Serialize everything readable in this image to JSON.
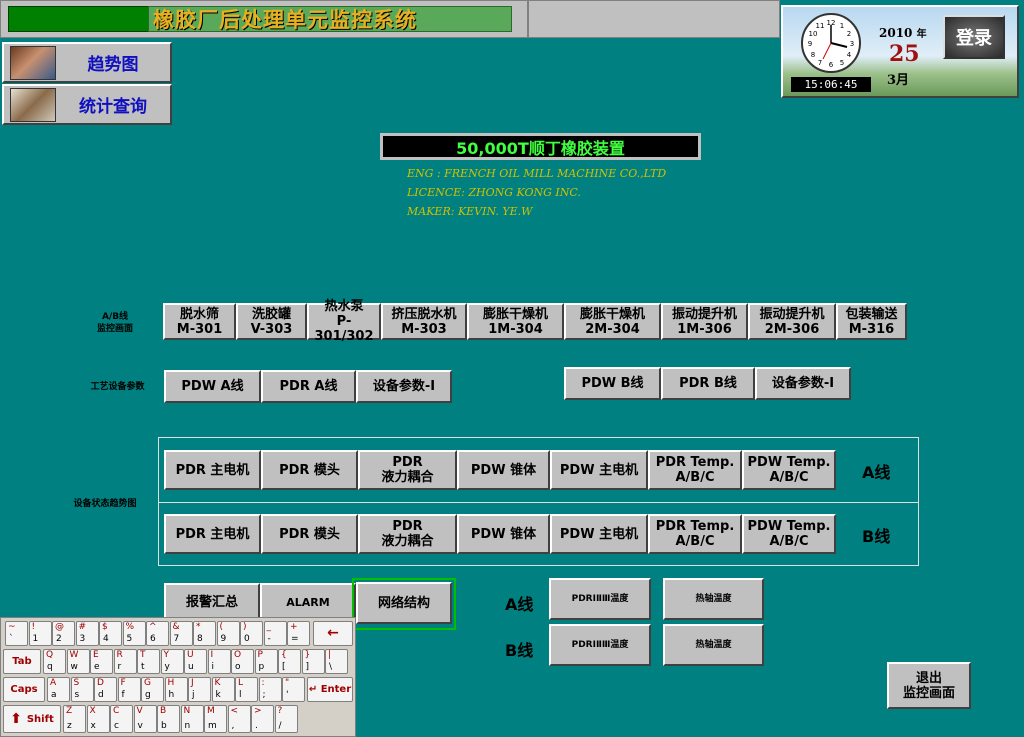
{
  "header": {
    "title": "橡胶厂后处理单元监控系统"
  },
  "nav": {
    "trend": "趋势图",
    "stats": "统计查询"
  },
  "clock": {
    "time": "15:06:45",
    "year": "2010",
    "year_suffix": "年",
    "day": "25",
    "month": "3月",
    "login": "登录"
  },
  "product": {
    "name": "50,000T顺丁橡胶装置",
    "eng": "ENG : FRENCH OIL MILL MACHINE CO.,LTD",
    "licence": "LICENCE: ZHONG KONG INC.",
    "maker": "MAKER: KEVIN.  YE.W"
  },
  "ab_lines": {
    "label_1": "A/B线",
    "label_2": "监控画面",
    "buttons": [
      {
        "l1": "脱水筛",
        "l2": "M-301"
      },
      {
        "l1": "洗胶罐",
        "l2": "V-303"
      },
      {
        "l1": "热水泵",
        "l2": "P-301/302"
      },
      {
        "l1": "挤压脱水机",
        "l2": "M-303"
      },
      {
        "l1": "膨胀干燥机",
        "l2": "1M-304"
      },
      {
        "l1": "膨胀干燥机",
        "l2": "2M-304"
      },
      {
        "l1": "振动提升机",
        "l2": "1M-306"
      },
      {
        "l1": "振动提升机",
        "l2": "2M-306"
      },
      {
        "l1": "包装输送",
        "l2": "M-316"
      }
    ]
  },
  "process": {
    "label": "工艺设备参数",
    "a_buttons": [
      "PDW A线",
      "PDR A线",
      "设备参数-I"
    ],
    "b_buttons": [
      "PDW B线",
      "PDR B线",
      "设备参数-I"
    ]
  },
  "trend": {
    "label": "设备状态趋势图",
    "line_a": "A线",
    "line_b": "B线",
    "buttons": [
      {
        "l1": "PDR 主电机",
        "l2": ""
      },
      {
        "l1": "PDR 模头",
        "l2": ""
      },
      {
        "l1": "PDR",
        "l2": "液力耦合"
      },
      {
        "l1": "PDW 锥体",
        "l2": ""
      },
      {
        "l1": "PDW 主电机",
        "l2": ""
      },
      {
        "l1": "PDR Temp.",
        "l2": "A/B/C"
      },
      {
        "l1": "PDW Temp.",
        "l2": "A/B/C"
      }
    ]
  },
  "bottom": {
    "alarm_summary": "报警汇总",
    "alarm": "ALARM",
    "network": "网络结构",
    "line_a": "A线",
    "line_b": "B线",
    "pdr_temp": "PDRⅠⅡⅢ温度",
    "oil_temp": "热轴温度",
    "exit_1": "退出",
    "exit_2": "监控画面"
  },
  "keyboard": {
    "rows": [
      [
        [
          "~",
          "`"
        ],
        [
          "!",
          "1"
        ],
        [
          "@",
          "2"
        ],
        [
          "#",
          "3"
        ],
        [
          "$",
          "4"
        ],
        [
          "%",
          "5"
        ],
        [
          "^",
          "6"
        ],
        [
          "&",
          "7"
        ],
        [
          "*",
          "8"
        ],
        [
          "(",
          "9"
        ],
        [
          ")",
          "0"
        ],
        [
          "_",
          "-"
        ],
        [
          "+",
          "="
        ]
      ],
      [
        [
          "Q",
          "q"
        ],
        [
          "W",
          "w"
        ],
        [
          "E",
          "e"
        ],
        [
          "R",
          "r"
        ],
        [
          "T",
          "t"
        ],
        [
          "Y",
          "y"
        ],
        [
          "U",
          "u"
        ],
        [
          "I",
          "i"
        ],
        [
          "O",
          "o"
        ],
        [
          "P",
          "p"
        ],
        [
          "{",
          "["
        ],
        [
          "}",
          "]"
        ],
        [
          "|",
          "\\"
        ]
      ],
      [
        [
          "A",
          "a"
        ],
        [
          "S",
          "s"
        ],
        [
          "D",
          "d"
        ],
        [
          "F",
          "f"
        ],
        [
          "G",
          "g"
        ],
        [
          "H",
          "h"
        ],
        [
          "J",
          "j"
        ],
        [
          "K",
          "k"
        ],
        [
          "L",
          "l"
        ],
        [
          ":",
          ";"
        ],
        [
          "\"",
          "'"
        ]
      ],
      [
        [
          "Z",
          "z"
        ],
        [
          "X",
          "x"
        ],
        [
          "C",
          "c"
        ],
        [
          "V",
          "v"
        ],
        [
          "B",
          "b"
        ],
        [
          "N",
          "n"
        ],
        [
          "M",
          "m"
        ],
        [
          "<",
          ","
        ],
        [
          ">",
          "."
        ],
        [
          "?",
          "/"
        ]
      ]
    ],
    "backspace": "←",
    "tab": "Tab",
    "caps": "Caps",
    "enter": "Enter",
    "shift": "Shift"
  }
}
